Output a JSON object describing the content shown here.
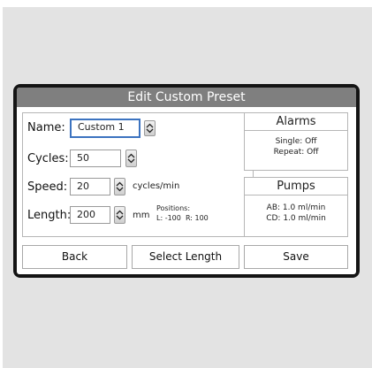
{
  "dialog": {
    "title": "Edit Custom Preset"
  },
  "form": {
    "name": {
      "label": "Name:",
      "value": "Custom 1"
    },
    "cycles": {
      "label": "Cycles:",
      "value": "50"
    },
    "speed": {
      "label": "Speed:",
      "value": "20",
      "unit": "cycles/min"
    },
    "length": {
      "label": "Length:",
      "value": "200",
      "unit": "mm",
      "positions_label": "Positions:",
      "positions_value": "L: -100  R: 100"
    }
  },
  "alarms": {
    "title": "Alarms",
    "single": "Single: Off",
    "repeat": "Repeat: Off"
  },
  "pumps": {
    "title": "Pumps",
    "ab": "AB: 1.0 ml/min",
    "cd": "CD: 1.0 ml/min"
  },
  "buttons": {
    "back": "Back",
    "select_length": "Select Length",
    "save": "Save"
  },
  "icons": {
    "spinner": "up-down-spinner-icon"
  },
  "colors": {
    "title_bar": "#7f7f7f",
    "active_border": "#3c73c0",
    "frame": "#141414"
  }
}
